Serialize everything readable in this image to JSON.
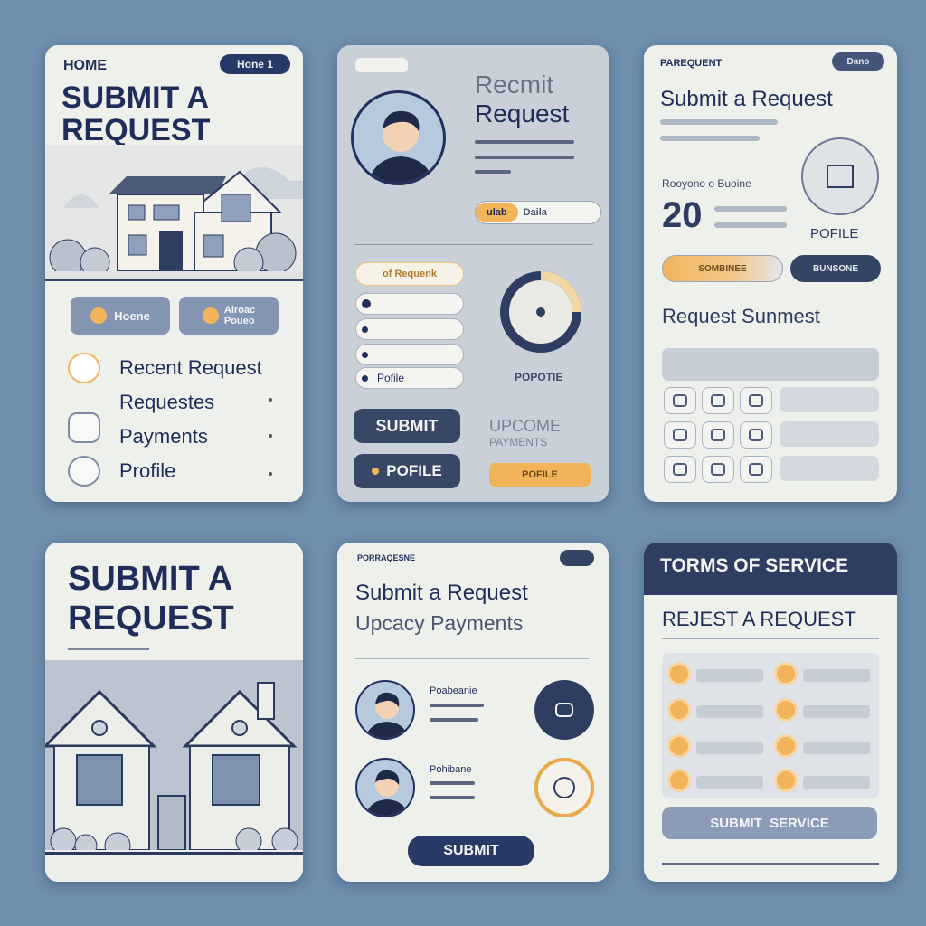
{
  "card1": {
    "home": "HOME",
    "badge": "Hone 1",
    "title_line1": "SUBMIT A",
    "title_line2": "REQUEST",
    "btn_home": "Hoene",
    "btn_right_line1": "Alroac",
    "btn_right_line2": "Poueo",
    "menu": [
      {
        "label": "Recent Request",
        "icon": "note-icon"
      },
      {
        "label": "Requestes",
        "icon": ""
      },
      {
        "label": "Payments",
        "icon": "image-icon"
      },
      {
        "label": "Profile",
        "icon": "camera-icon"
      }
    ]
  },
  "card2": {
    "title_line1": "Recmit",
    "title_line2": "Request",
    "btn_orange": "ulab",
    "btn_white": "Daila",
    "field_orange": "of Requenk",
    "submit": "SUBMIT",
    "profile_btn": "POFILE",
    "donut_label": "POPOTIE",
    "upcoming_line1": "UPCOME",
    "upcoming_line2": "PAYMENTS",
    "profile_orange": "POFILE",
    "list_last": "Pofile"
  },
  "card3": {
    "header": "PAREQUENT",
    "badge": "Dano",
    "title": "Submit a Request",
    "subtitle": "Rooyono o Buoine",
    "number": "20",
    "profile": "POFILE",
    "btn_orange": "SOMBINEE",
    "btn_navy": "BUNSONE",
    "section": "Request Sunmest"
  },
  "card4": {
    "title_line1": "SUBMIT A",
    "title_line2": "REQUEST"
  },
  "card5": {
    "header": "PORRAQESNE",
    "title": "Submit a Request",
    "subtitle": "Upcacy Payments",
    "person1": "Poabeanie",
    "person2": "Pohibane",
    "submit": "SUBMIT"
  },
  "card6": {
    "header": "TORMS OF SERVICE",
    "title": "REJEST A REQUEST",
    "button": "SUBMIT  SERVICE"
  }
}
